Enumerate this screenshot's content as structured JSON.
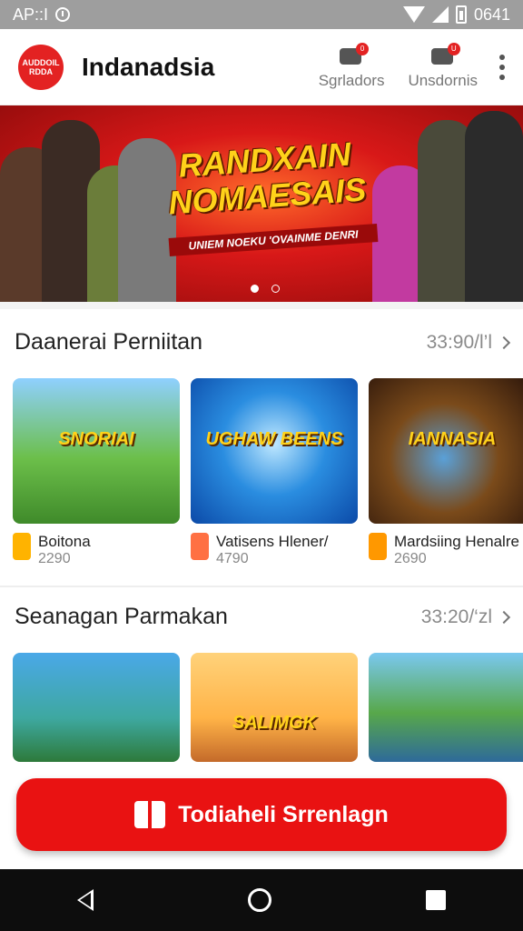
{
  "status_bar": {
    "left_text": "AP::I",
    "time": "0641"
  },
  "app_bar": {
    "logo_text": "AUDDOIL RDDA",
    "title": "Indanadsia",
    "actions": [
      {
        "label": "Sgrladors",
        "icon": "controller-icon",
        "badge": "0"
      },
      {
        "label": "Unsdornis",
        "icon": "inbox-icon",
        "badge": "U"
      }
    ]
  },
  "banner": {
    "title": "RANDXAIN NOMAESAIS",
    "tagline": "UNIEM NOEKU 'OVAINME DENRI",
    "slides": 2,
    "active_slide": 0
  },
  "sections": [
    {
      "title": "Daanerai Perniitan",
      "more": "33:90/l’l",
      "items": [
        {
          "name": "Boitona",
          "count": "2290",
          "art_text": "SNORIAI",
          "icon_color": "#ffb300"
        },
        {
          "name": "Vatisens Hlener/",
          "count": "4790",
          "art_text": "UGHAW BEENS",
          "icon_color": "#ff7043"
        },
        {
          "name": "Mardsiing Henalre",
          "count": "2690",
          "art_text": "IANNASIA",
          "icon_color": "#ff9800"
        }
      ]
    },
    {
      "title": "Seanagan Parmakan",
      "more": "33:20/‘zl",
      "items": [
        {
          "name": "",
          "count": "",
          "art_text": ""
        },
        {
          "name": "",
          "count": "",
          "art_text": "SALIMGK"
        },
        {
          "name": "",
          "count": "",
          "art_text": ""
        }
      ]
    }
  ],
  "cta": {
    "label": "Todiaheli Srrenlagn",
    "icon": "gift-icon"
  },
  "nav": {
    "back": "back-icon",
    "home": "home-icon",
    "recent": "recent-apps-icon"
  }
}
